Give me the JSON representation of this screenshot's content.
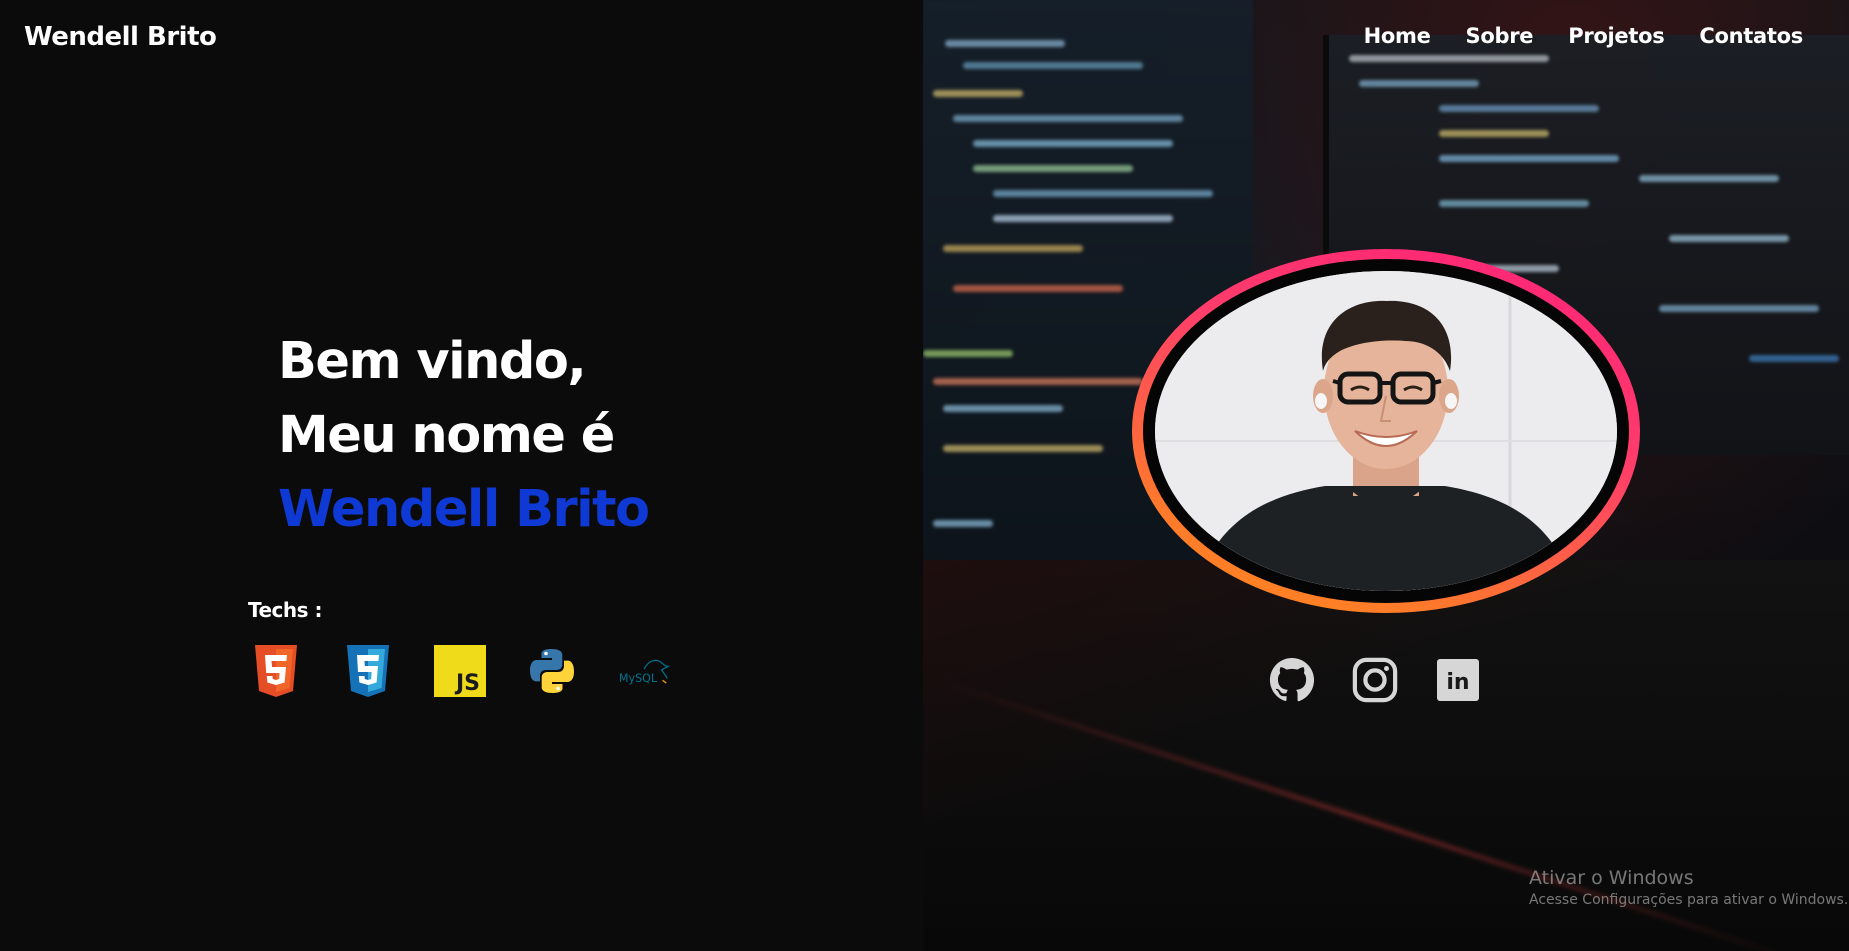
{
  "header": {
    "brand": "Wendell Brito",
    "nav": [
      "Home",
      "Sobre",
      "Projetos",
      "Contatos"
    ]
  },
  "hero": {
    "line1": "Bem vindo,",
    "line2": "Meu nome é",
    "name": "Wendell Brito"
  },
  "techs": {
    "label": "Techs :",
    "icons": [
      "html5-icon",
      "css3-icon",
      "javascript-icon",
      "python-icon",
      "mysql-icon"
    ],
    "js_text": "JS",
    "mysql_text": "MySQL"
  },
  "socials": {
    "icons": [
      "github-icon",
      "instagram-icon",
      "linkedin-icon"
    ],
    "linkedin_text": "in"
  },
  "colors": {
    "accent_blue": "#0f39d4",
    "ring_gradient": [
      "#ff1f7a",
      "#ff8c1a"
    ]
  },
  "windows_watermark": {
    "title": "Ativar o Windows",
    "subtitle": "Acesse Configurações para ativar o Windows."
  }
}
